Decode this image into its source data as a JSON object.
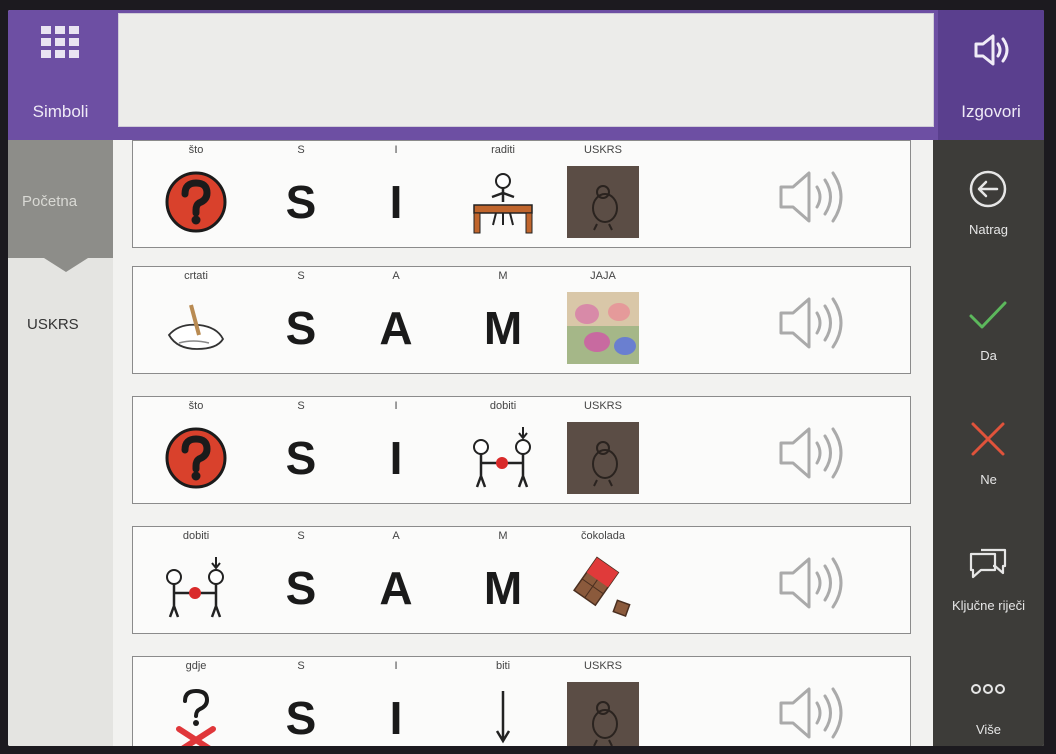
{
  "topbar": {
    "symbols_label": "Simboli",
    "speak_label": "Izgovori",
    "message_text": ""
  },
  "sidebar": {
    "items": [
      {
        "label": "Početna",
        "active": true
      },
      {
        "label": "USKRS",
        "active": false
      }
    ]
  },
  "rows": [
    {
      "cells": [
        {
          "caption": "što",
          "type": "question-symbol"
        },
        {
          "caption": "S",
          "letter": "S"
        },
        {
          "caption": "I",
          "letter": "I"
        },
        {
          "caption": "raditi",
          "type": "desk-symbol"
        },
        {
          "caption": "USKRS",
          "type": "chick-photo"
        }
      ]
    },
    {
      "cells": [
        {
          "caption": "crtati",
          "type": "drawing-hand-symbol"
        },
        {
          "caption": "S",
          "letter": "S"
        },
        {
          "caption": "A",
          "letter": "A"
        },
        {
          "caption": "M",
          "letter": "M"
        },
        {
          "caption": "JAJA",
          "type": "eggs-photo"
        }
      ]
    },
    {
      "cells": [
        {
          "caption": "što",
          "type": "question-symbol"
        },
        {
          "caption": "S",
          "letter": "S"
        },
        {
          "caption": "I",
          "letter": "I"
        },
        {
          "caption": "dobiti",
          "type": "receive-symbol"
        },
        {
          "caption": "USKRS",
          "type": "chick-photo"
        }
      ]
    },
    {
      "cells": [
        {
          "caption": "dobiti",
          "type": "receive-symbol"
        },
        {
          "caption": "S",
          "letter": "S"
        },
        {
          "caption": "A",
          "letter": "A"
        },
        {
          "caption": "M",
          "letter": "M"
        },
        {
          "caption": "čokolada",
          "type": "chocolate-symbol"
        }
      ]
    },
    {
      "cells": [
        {
          "caption": "gdje",
          "type": "where-symbol"
        },
        {
          "caption": "S",
          "letter": "S"
        },
        {
          "caption": "I",
          "letter": "I"
        },
        {
          "caption": "biti",
          "type": "be-symbol"
        },
        {
          "caption": "USKRS",
          "type": "chick-photo"
        }
      ]
    }
  ],
  "rightbar": {
    "back_label": "Natrag",
    "yes_label": "Da",
    "no_label": "Ne",
    "keywords_label": "Ključne riječi",
    "more_label": "Više"
  },
  "colors": {
    "accent_purple": "#6d4fa3",
    "yes_green": "#5cb85c",
    "no_red": "#e0533b",
    "question_red": "#d9412c"
  }
}
